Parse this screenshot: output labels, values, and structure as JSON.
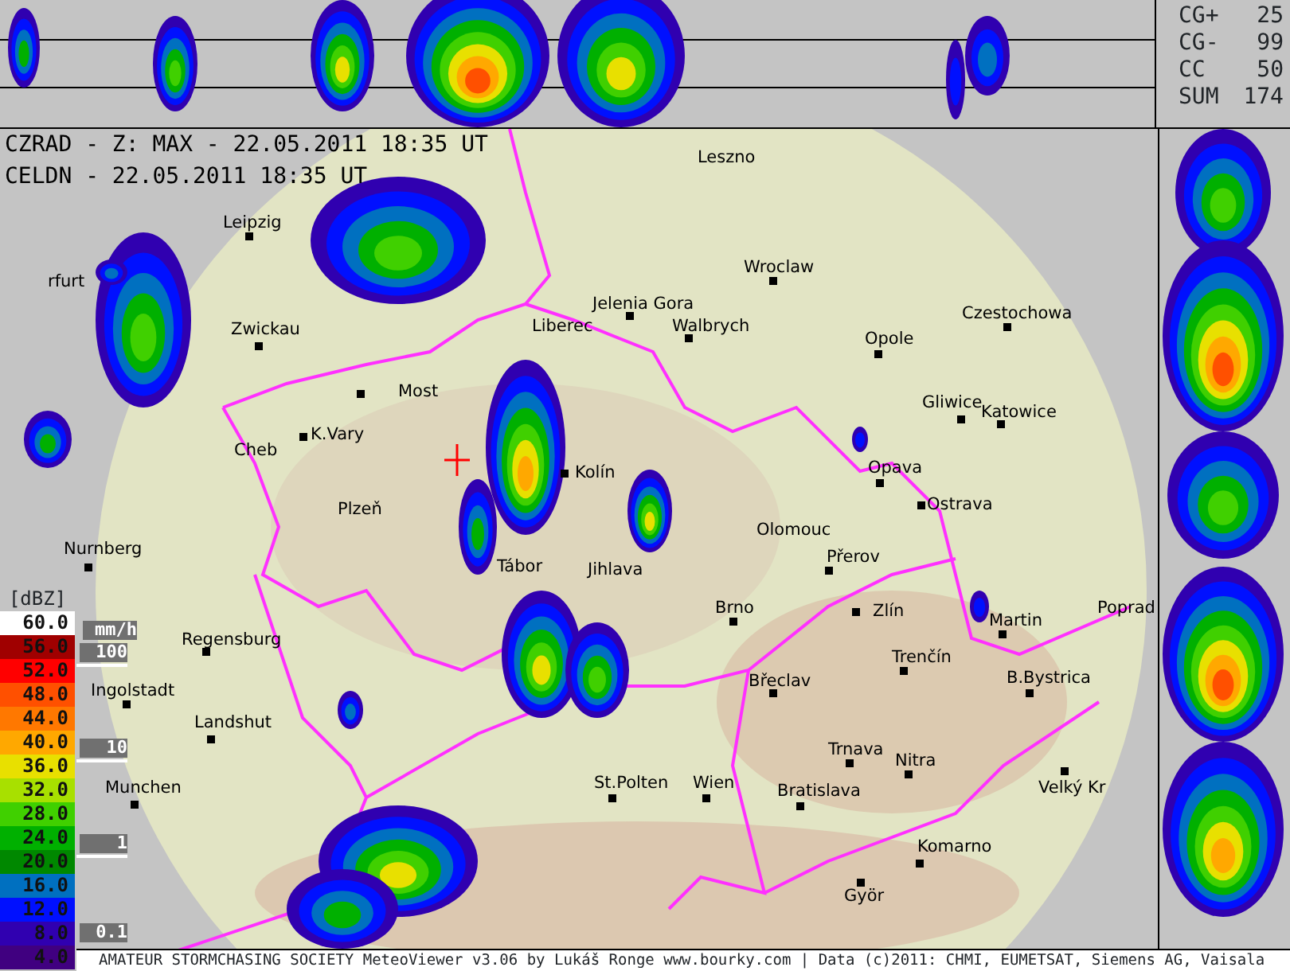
{
  "header": {
    "lines": [
      "CZRAD - Z: MAX - 22.05.2011 18:35 UT",
      "CELDN - 22.05.2011 18:35 UT"
    ]
  },
  "lightning_stats": [
    {
      "label": "CG+",
      "value": "25"
    },
    {
      "label": "CG-",
      "value": "99"
    },
    {
      "label": "CC",
      "value": "50"
    },
    {
      "label": "SUM",
      "value": "174"
    }
  ],
  "map": {
    "cities": [
      {
        "name": "Leszno"
      },
      {
        "name": "Leipzig"
      },
      {
        "name": "rfurt"
      },
      {
        "name": "Zwickau"
      },
      {
        "name": "Wroclaw"
      },
      {
        "name": "Jelenia Gora"
      },
      {
        "name": "Walbrych"
      },
      {
        "name": "Opole"
      },
      {
        "name": "Czestochowa"
      },
      {
        "name": "Liberec"
      },
      {
        "name": "Most"
      },
      {
        "name": "K.Vary"
      },
      {
        "name": "Cheb"
      },
      {
        "name": "Plzeň"
      },
      {
        "name": "Kolín"
      },
      {
        "name": "Gliwice"
      },
      {
        "name": "Katowice"
      },
      {
        "name": "Opava"
      },
      {
        "name": "Ostrava"
      },
      {
        "name": "Olomouc"
      },
      {
        "name": "Přerov"
      },
      {
        "name": "Nurnberg"
      },
      {
        "name": "Tábor"
      },
      {
        "name": "Jihlava"
      },
      {
        "name": "Brno"
      },
      {
        "name": "Zlín"
      },
      {
        "name": "Martin"
      },
      {
        "name": "Poprad"
      },
      {
        "name": "Regensburg"
      },
      {
        "name": "Trenčín"
      },
      {
        "name": "Ingolstadt"
      },
      {
        "name": "Břeclav"
      },
      {
        "name": "B.Bystrica"
      },
      {
        "name": "Landshut"
      },
      {
        "name": "Trnava"
      },
      {
        "name": "Nitra"
      },
      {
        "name": "Munchen"
      },
      {
        "name": "St.Polten"
      },
      {
        "name": "Wien"
      },
      {
        "name": "Bratislava"
      },
      {
        "name": "Velký Kr"
      },
      {
        "name": "Komarno"
      },
      {
        "name": "Györ"
      }
    ]
  },
  "legend": {
    "unit": "[dBZ]",
    "rain_unit": "mm/h",
    "levels": [
      {
        "value": "60.0",
        "color": "#ffffff"
      },
      {
        "value": "56.0",
        "color": "#a00000"
      },
      {
        "value": "52.0",
        "color": "#ff0000"
      },
      {
        "value": "48.0",
        "color": "#ff5000"
      },
      {
        "value": "44.0",
        "color": "#ff7800"
      },
      {
        "value": "40.0",
        "color": "#ffa800"
      },
      {
        "value": "36.0",
        "color": "#e8e000"
      },
      {
        "value": "32.0",
        "color": "#a8e000"
      },
      {
        "value": "28.0",
        "color": "#40d000"
      },
      {
        "value": "24.0",
        "color": "#00b000"
      },
      {
        "value": "20.0",
        "color": "#008800"
      },
      {
        "value": "16.0",
        "color": "#0070c0"
      },
      {
        "value": "12.0",
        "color": "#0010ff"
      },
      {
        "value": "8.0",
        "color": "#3000b0"
      },
      {
        "value": "4.0",
        "color": "#400080"
      }
    ],
    "rain_marks": [
      "100",
      "10",
      "1",
      "0.1"
    ]
  },
  "footer": "AMATEUR STORMCHASING SOCIETY MeteoViewer v3.06 by Lukáš Ronge www.bourky.com | Data (c)2011: CHMI, EUMETSAT, Siemens AG, Vaisala"
}
